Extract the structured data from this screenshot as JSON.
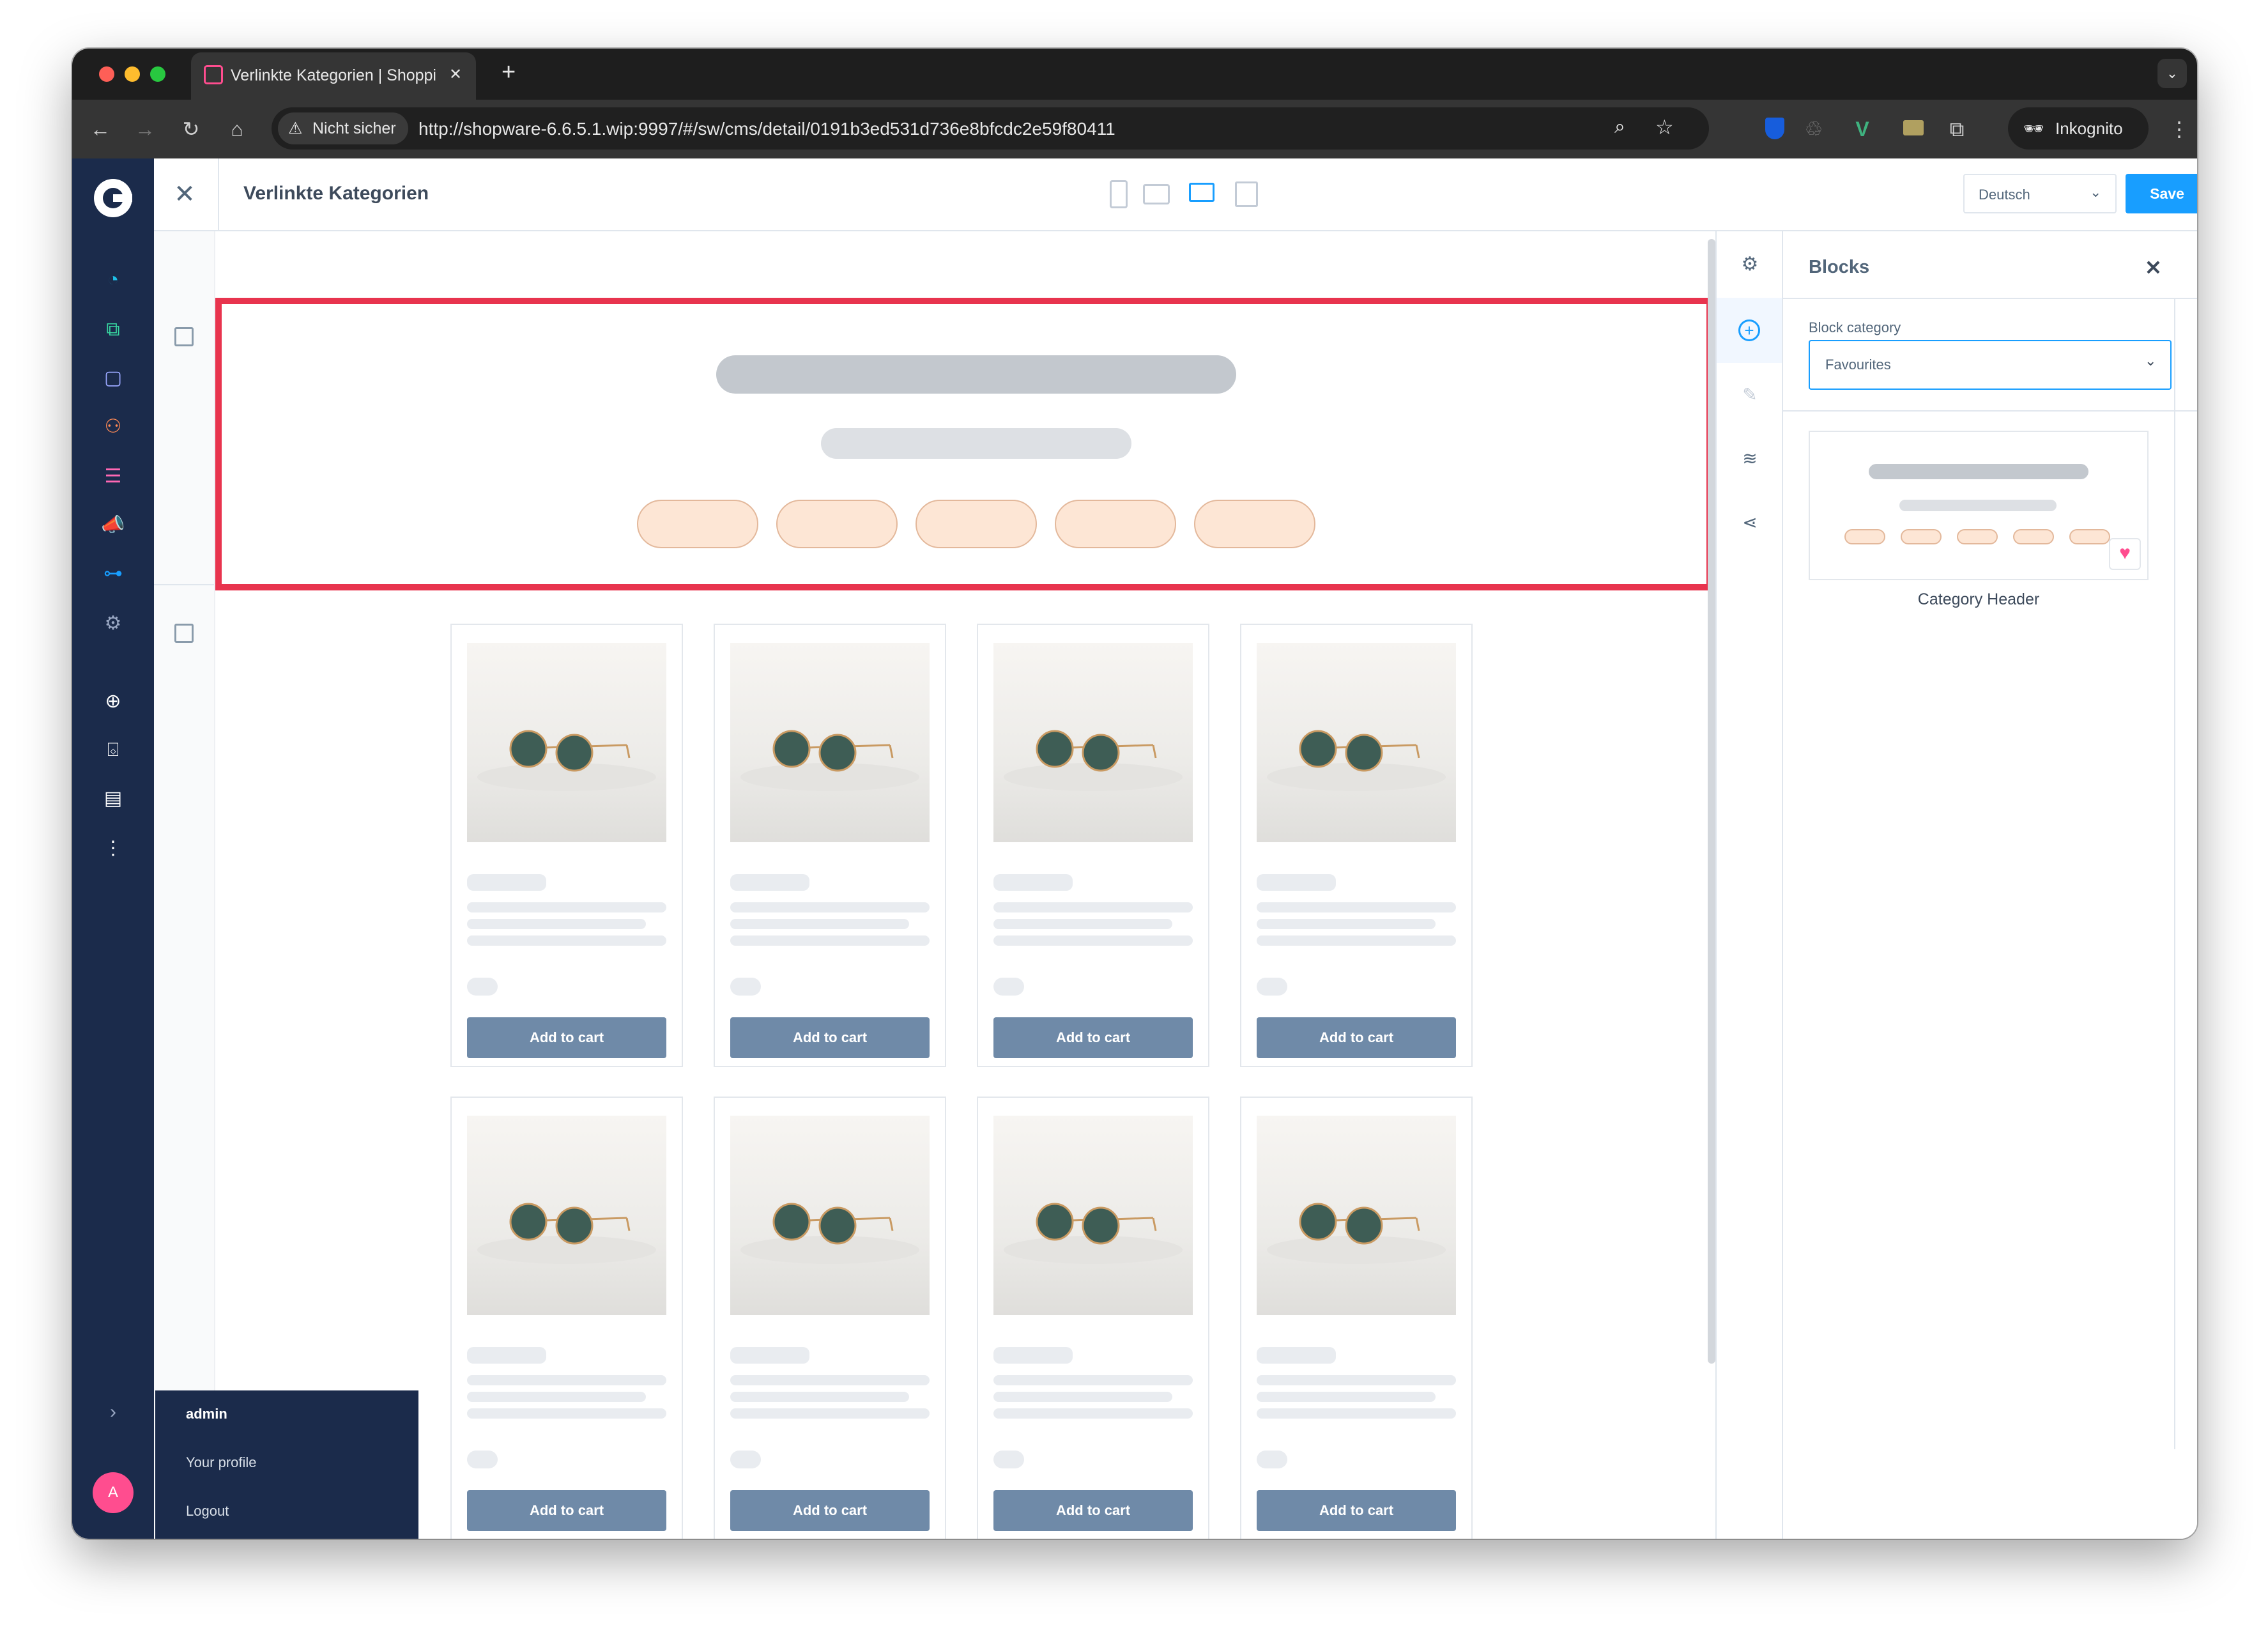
{
  "browser": {
    "tab_title": "Verlinkte Kategorien | Shoppi",
    "tab_close": "✕",
    "new_tab": "+",
    "security_label": "Nicht sicher",
    "url": "http://shopware-6.6.5.1.wip:9997/#/sw/cms/detail/0191b3ed531d736e8bfcdc2e59f80411",
    "incognito_label": "Inkognito"
  },
  "header": {
    "title": "Verlinkte Kategorien",
    "language": "Deutsch",
    "save_label": "Save"
  },
  "panel": {
    "title": "Blocks",
    "category_label": "Block category",
    "category_value": "Favourites",
    "block_name": "Category Header"
  },
  "product_button_label": "Add to cart",
  "user_menu": {
    "name": "admin",
    "profile": "Your profile",
    "logout": "Logout"
  },
  "avatar_initial": "A",
  "colors": {
    "brand": "#189eff",
    "sidebar": "#1b2b4b",
    "highlight": "#e8344e",
    "pill_fill": "#fde6d5",
    "favourite": "#ff4d8f"
  }
}
